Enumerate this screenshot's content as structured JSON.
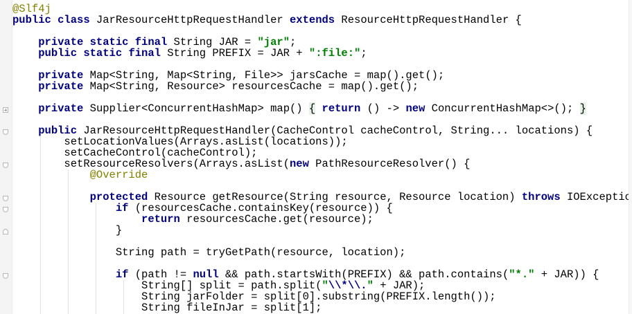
{
  "editor": {
    "language": "java",
    "colors": {
      "background": "#ffffff",
      "keyword": "#000080",
      "annotation": "#808000",
      "string": "#008000",
      "default": "#000000",
      "fold_highlight": "#e4f1e4"
    },
    "lines": [
      {
        "tokens": [
          {
            "t": "@Slf4j",
            "c": "an"
          }
        ]
      },
      {
        "tokens": [
          {
            "t": "public class",
            "c": "kw"
          },
          {
            "t": " JarResourceHttpRequestHandler "
          },
          {
            "t": "extends",
            "c": "kw"
          },
          {
            "t": " ResourceHttpRequestHandler {"
          }
        ]
      },
      {
        "tokens": []
      },
      {
        "tokens": [
          {
            "t": "    "
          },
          {
            "t": "private static final",
            "c": "kw"
          },
          {
            "t": " String JAR = "
          },
          {
            "t": "\"jar\"",
            "c": "st"
          },
          {
            "t": ";"
          }
        ]
      },
      {
        "tokens": [
          {
            "t": "    "
          },
          {
            "t": "public static final",
            "c": "kw"
          },
          {
            "t": " String PREFIX = JAR + "
          },
          {
            "t": "\":file:\"",
            "c": "st"
          },
          {
            "t": ";"
          }
        ]
      },
      {
        "tokens": []
      },
      {
        "tokens": [
          {
            "t": "    "
          },
          {
            "t": "private",
            "c": "kw"
          },
          {
            "t": " Map<String, Map<String, File>> jarsCache = map().get();"
          }
        ]
      },
      {
        "tokens": [
          {
            "t": "    "
          },
          {
            "t": "private",
            "c": "kw"
          },
          {
            "t": " Map<String, Resource> resourcesCache = map().get();"
          }
        ]
      },
      {
        "tokens": []
      },
      {
        "tokens": [
          {
            "t": "    "
          },
          {
            "t": "private",
            "c": "kw"
          },
          {
            "t": " Supplier<ConcurrentHashMap> map() "
          },
          {
            "t": "{",
            "c": "hl"
          },
          {
            "t": " "
          },
          {
            "t": "return",
            "c": "kw"
          },
          {
            "t": " () -> "
          },
          {
            "t": "new",
            "c": "kw"
          },
          {
            "t": " ConcurrentHashMap<>(); "
          },
          {
            "t": "}",
            "c": "hl"
          }
        ]
      },
      {
        "tokens": []
      },
      {
        "tokens": [
          {
            "t": "    "
          },
          {
            "t": "public",
            "c": "kw"
          },
          {
            "t": " JarResourceHttpRequestHandler(CacheControl cacheControl, String... locations) {"
          }
        ]
      },
      {
        "tokens": [
          {
            "t": "        setLocationValues(Arrays.asList(locations));"
          }
        ]
      },
      {
        "tokens": [
          {
            "t": "        setCacheControl(cacheControl);"
          }
        ]
      },
      {
        "tokens": [
          {
            "t": "        setResourceResolvers(Arrays.asList("
          },
          {
            "t": "new",
            "c": "kw"
          },
          {
            "t": " PathResourceResolver() {"
          }
        ]
      },
      {
        "tokens": [
          {
            "t": "            "
          },
          {
            "t": "@Override",
            "c": "an"
          }
        ]
      },
      {
        "tokens": []
      },
      {
        "tokens": [
          {
            "t": "            "
          },
          {
            "t": "protected",
            "c": "kw"
          },
          {
            "t": " Resource getResource(String resource, Resource location) "
          },
          {
            "t": "throws",
            "c": "kw"
          },
          {
            "t": " IOException {"
          }
        ]
      },
      {
        "tokens": [
          {
            "t": "                "
          },
          {
            "t": "if",
            "c": "kw"
          },
          {
            "t": " (resourcesCache.containsKey(resource)) {"
          }
        ]
      },
      {
        "tokens": [
          {
            "t": "                    "
          },
          {
            "t": "return",
            "c": "kw"
          },
          {
            "t": " resourcesCache.get(resource);"
          }
        ]
      },
      {
        "tokens": [
          {
            "t": "                }"
          }
        ]
      },
      {
        "tokens": []
      },
      {
        "tokens": [
          {
            "t": "                String path = tryGetPath(resource, location);"
          }
        ]
      },
      {
        "tokens": []
      },
      {
        "tokens": [
          {
            "t": "                "
          },
          {
            "t": "if",
            "c": "kw"
          },
          {
            "t": " (path != "
          },
          {
            "t": "null",
            "c": "kw"
          },
          {
            "t": " && path.startsWith(PREFIX) && path.contains("
          },
          {
            "t": "\"*.\"",
            "c": "st"
          },
          {
            "t": " + JAR)) {"
          }
        ]
      },
      {
        "tokens": [
          {
            "t": "                    String[] split = path.split("
          },
          {
            "t": "\"",
            "c": "st"
          },
          {
            "t": "\\\\*\\\\.",
            "c": "esc"
          },
          {
            "t": "\"",
            "c": "st"
          },
          {
            "t": " + JAR);"
          }
        ]
      },
      {
        "tokens": [
          {
            "t": "                    String jarFolder = split[0].substring(PREFIX.length());"
          }
        ]
      },
      {
        "tokens": [
          {
            "t": "                    String fileInJar = split[1];"
          }
        ]
      }
    ]
  }
}
